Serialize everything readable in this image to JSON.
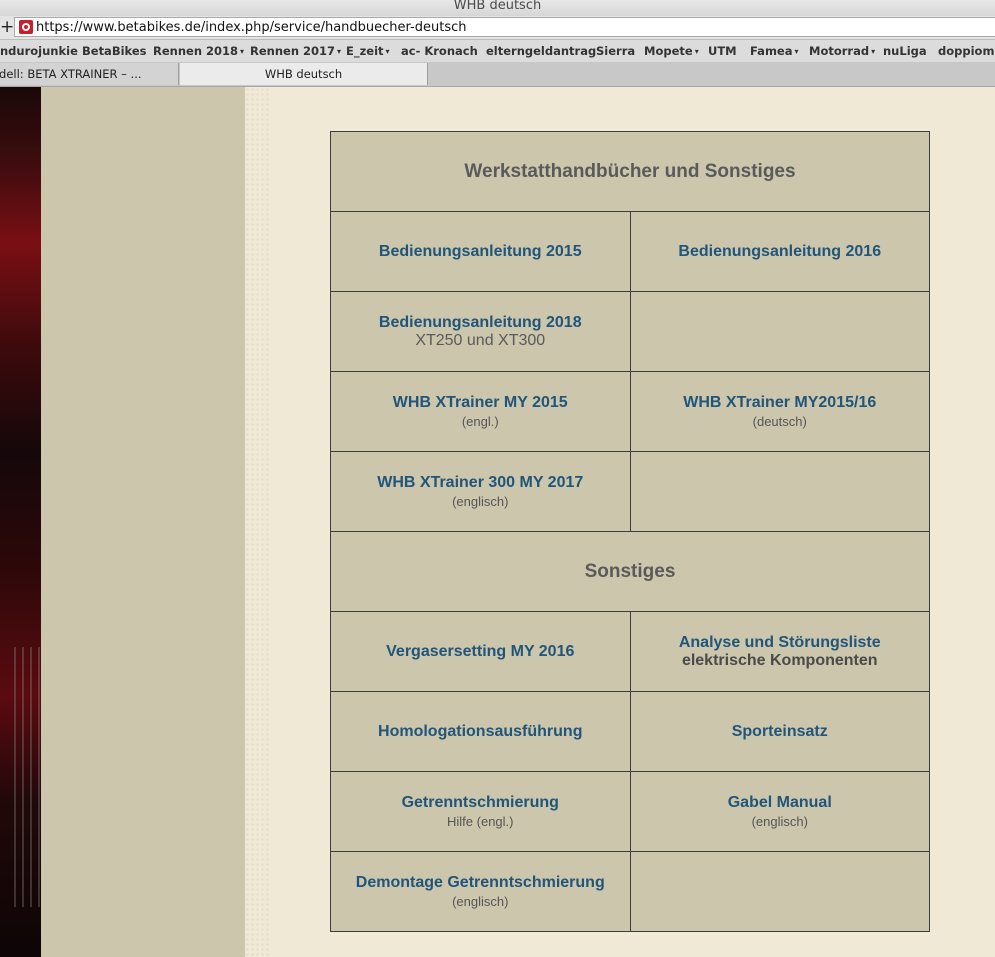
{
  "window": {
    "title": "WHB deutsch"
  },
  "address_bar": {
    "plus": "+",
    "url": "https://www.betabikes.de/index.php/service/handbuecher-deutsch"
  },
  "bookmarks": [
    {
      "label": "ndurojunkie"
    },
    {
      "label": "BetaBikes"
    },
    {
      "label": "Rennen 2018",
      "arrow": "▾"
    },
    {
      "label": "Rennen 2017",
      "arrow": "▾"
    },
    {
      "label": "E_zeit",
      "arrow": "▾"
    },
    {
      "label": "ac- Kronach"
    },
    {
      "label": "elterngeldantrag"
    },
    {
      "label": "Sierra"
    },
    {
      "label": "Mopete",
      "arrow": "▾"
    },
    {
      "label": "UTM"
    },
    {
      "label": "Famea",
      "arrow": "▾"
    },
    {
      "label": "Motorrad",
      "arrow": "▾"
    },
    {
      "label": "nuLiga"
    },
    {
      "label": "doppiome:"
    }
  ],
  "tabs": [
    {
      "label": "odell: BETA XTRAINER – ..."
    },
    {
      "label": "WHB deutsch"
    }
  ],
  "manuals": {
    "heading": "Werkstatthandbücher und Sonstiges",
    "r1": {
      "a": "Bedienungsanleitung 2015",
      "b": "Bedienungsanleitung 2016"
    },
    "r2": {
      "a": "Bedienungsanleitung 2018",
      "a_sub": "XT250 und XT300"
    },
    "r3": {
      "a": "WHB XTrainer MY 2015",
      "a_sub": "(engl.)",
      "b": "WHB XTrainer MY2015/16",
      "b_sub": "(deutsch)"
    },
    "r4": {
      "a": "WHB XTrainer 300 MY 2017",
      "a_sub": "(englisch)"
    },
    "section2": "Sonstiges",
    "r5": {
      "a": "Vergasersetting MY 2016",
      "b": "Analyse und Störungsliste",
      "b_sub": "elektrische Komponenten"
    },
    "r6": {
      "a": "Homologationsausführung",
      "b": "Sporteinsatz"
    },
    "r7": {
      "a": "Getrenntschmierung",
      "a_sub": "Hilfe (engl.)",
      "b": "Gabel Manual",
      "b_sub": "(englisch)"
    },
    "r8": {
      "a": "Demontage Getrenntschmierung",
      "a_sub": "(englisch)"
    }
  },
  "colors": {
    "link": "#21557a",
    "cell_bg": "#ccc6ad",
    "page_bg": "#efe9d6",
    "border": "#3d3d3d"
  }
}
